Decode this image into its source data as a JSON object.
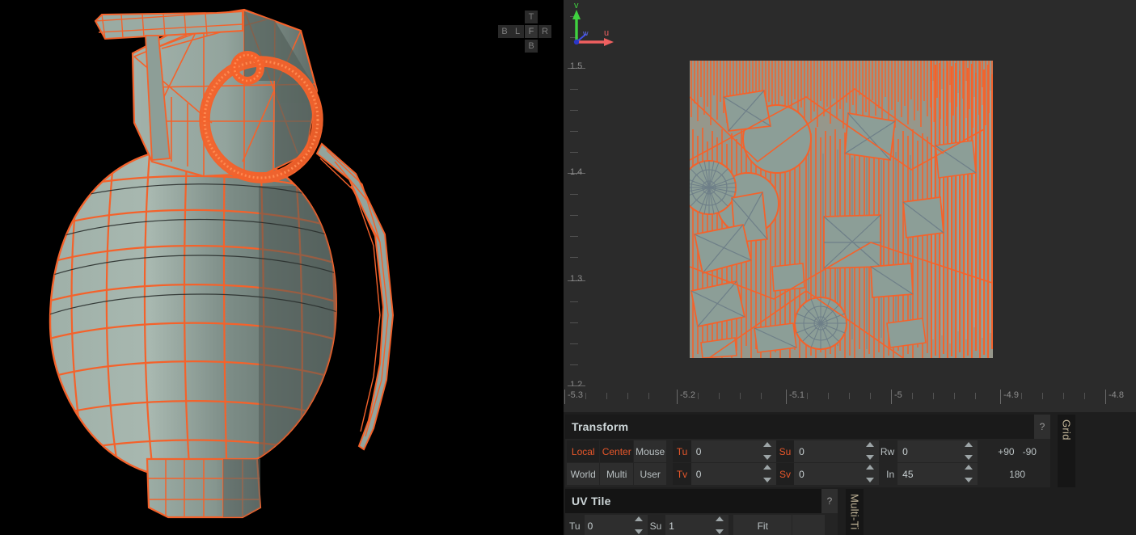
{
  "app": {
    "background_color": "#1e1e1e",
    "accent_color": "#e8572a",
    "wireframe_color": "#f4622b",
    "surface_color": "#97a9a3",
    "panel_color": "#242424"
  },
  "viewport_3d": {
    "name": "3d-viewport",
    "background_color": "#000000",
    "model": "hand-grenade",
    "shading": "wireframe-over-shaded",
    "view_cube": {
      "top": "T",
      "back": "B",
      "left": "L",
      "front": "F",
      "right": "R",
      "bottom": "B"
    }
  },
  "uv_editor": {
    "name": "uv-editor",
    "background_color": "#2b2b2b",
    "v_axis_labels": [
      "1.5",
      "1.4",
      "1.3",
      "1.2"
    ],
    "u_axis_labels": [
      "-5.3",
      "-5.2",
      "-5.1",
      "-5",
      "-4.9",
      "-4.8"
    ],
    "gizmo": {
      "u_label": "u",
      "v_label": "v",
      "w_label": "w",
      "u_color": "#e85050",
      "v_color": "#3fd13f",
      "w_color": "#4050e8"
    }
  },
  "transform_panel": {
    "title": "Transform",
    "help": "?",
    "mode_buttons": [
      {
        "label": "Local",
        "active": true
      },
      {
        "label": "Center",
        "active": true
      },
      {
        "label": "Mouse",
        "active": false
      },
      {
        "label": "World",
        "active": false
      },
      {
        "label": "Multi",
        "active": false
      },
      {
        "label": "User",
        "active": false
      }
    ],
    "fields": [
      {
        "label": "Tu",
        "value": "0",
        "accent": true
      },
      {
        "label": "Su",
        "value": "0",
        "accent": true
      },
      {
        "label": "Rw",
        "value": "0",
        "accent": false
      },
      {
        "label": "Tv",
        "value": "0",
        "accent": true
      },
      {
        "label": "Sv",
        "value": "0",
        "accent": true
      },
      {
        "label": "In",
        "value": "45",
        "accent": false
      }
    ],
    "rotate_buttons": [
      "+90",
      "-90",
      "180"
    ]
  },
  "uv_tile_panel": {
    "title": "UV Tile",
    "help": "?",
    "tu_label": "Tu",
    "tu_value": "0",
    "su_label": "Su",
    "su_value": "1",
    "fit_label": "Fit"
  },
  "vertical_tabs": [
    {
      "label": "Grid",
      "name": "tab-grid"
    },
    {
      "label": "Multi-Ti",
      "name": "tab-multi-tile"
    }
  ]
}
